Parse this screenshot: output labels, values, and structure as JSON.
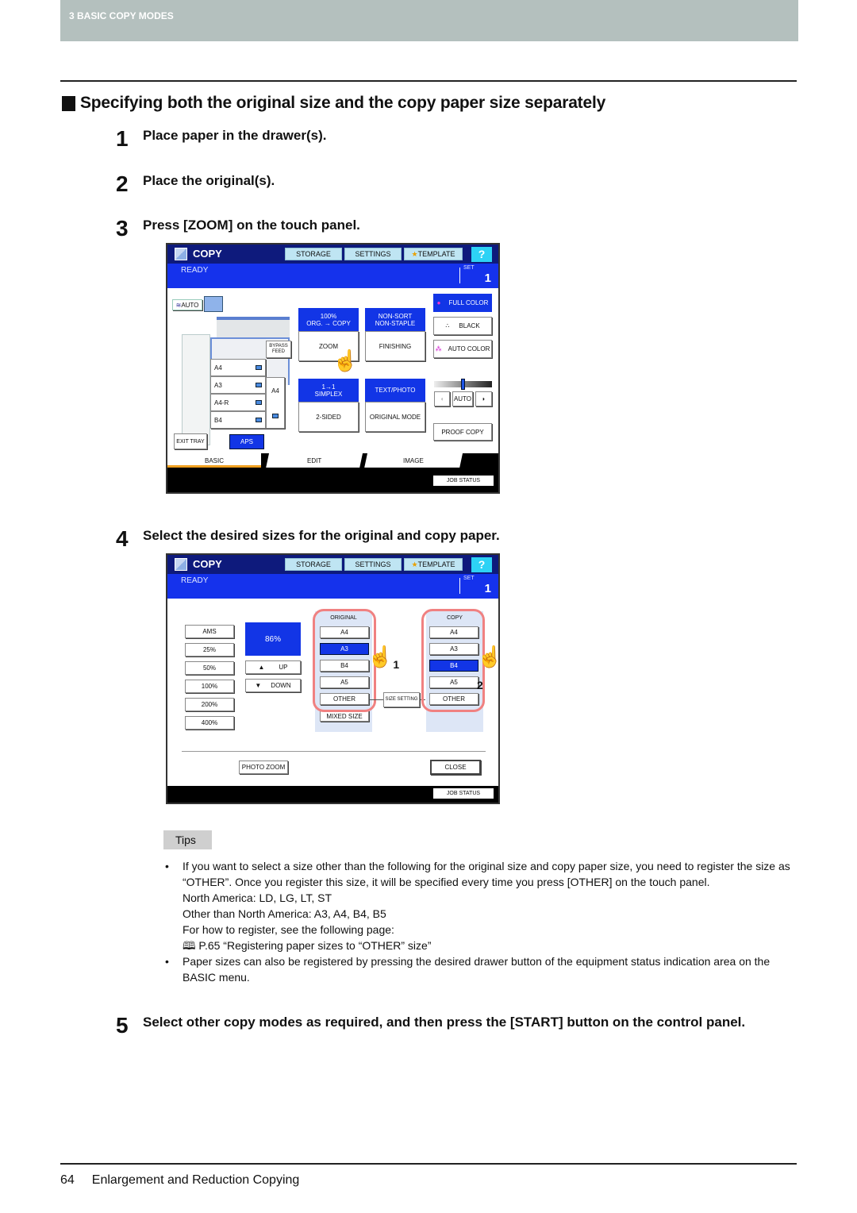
{
  "header": {
    "chapter": "3 BASIC COPY MODES"
  },
  "section_title": "Specifying both the original size and the copy paper size separately",
  "steps": [
    {
      "num": "1",
      "text": "Place paper in the drawer(s)."
    },
    {
      "num": "2",
      "text": "Place the original(s)."
    },
    {
      "num": "3",
      "text": "Press [ZOOM] on the touch panel."
    },
    {
      "num": "4",
      "text": "Select the desired sizes for the original and copy paper."
    },
    {
      "num": "5",
      "text": "Select other copy modes as required, and then press the [START] button on the control panel."
    }
  ],
  "panel_common": {
    "title": "COPY",
    "storage": "STORAGE",
    "settings": "SETTINGS",
    "template": "TEMPLATE",
    "help": "?",
    "status": "READY",
    "set_label": "SET",
    "set_value": "1",
    "job_status": "JOB STATUS"
  },
  "panel1": {
    "auto": "AUTO",
    "bypass_feed": "BYPASS FEED",
    "drawers": [
      "A4",
      "A3",
      "A4-R",
      "B4"
    ],
    "lcf": "A4",
    "exit_tray": "EXIT TRAY",
    "aps": "APS",
    "zoom_status": [
      "100%",
      "ORG. → COPY"
    ],
    "zoom": "ZOOM",
    "finishing_status": [
      "NON-SORT",
      "NON-STAPLE"
    ],
    "finishing": "FINISHING",
    "duplex_status": [
      "1→1",
      "SIMPLEX"
    ],
    "two_sided": "2-SIDED",
    "mode_status": "TEXT/PHOTO",
    "original_mode": "ORIGINAL MODE",
    "full_color": "FULL COLOR",
    "black": "BLACK",
    "auto_color": "AUTO COLOR",
    "density_auto": "AUTO",
    "proof_copy": "PROOF COPY",
    "tabs": [
      "BASIC",
      "EDIT",
      "IMAGE"
    ]
  },
  "panel2": {
    "presets": [
      "AMS",
      "25%",
      "50%",
      "100%",
      "200%",
      "400%"
    ],
    "zoom_value": "86%",
    "up": "UP",
    "down": "DOWN",
    "original_label": "ORIGINAL",
    "original_sizes": [
      "A4",
      "A3",
      "B4",
      "A5",
      "OTHER"
    ],
    "original_selected": "A3",
    "mixed_size": "MIXED SIZE",
    "size_setting": "SIZE SETTING",
    "copy_label": "COPY",
    "copy_sizes": [
      "A4",
      "A3",
      "B4",
      "A5",
      "OTHER"
    ],
    "copy_selected": "B4",
    "photo_zoom": "PHOTO ZOOM",
    "close": "CLOSE",
    "callouts": [
      "1",
      "2"
    ]
  },
  "tips": {
    "label": "Tips",
    "bullet1": "If you want to select a size other than the following for the original size and copy paper size, you need to register the size as “OTHER”. Once you register this size, it will be specified every time you press [OTHER] on the touch panel.",
    "na": "North America: LD, LG, LT, ST",
    "other": "Other than North America: A3, A4, B4, B5",
    "howto": "For how to register, see the following page:",
    "ref": "P.65 “Registering paper sizes to “OTHER” size”",
    "bullet2": "Paper sizes can also be registered by pressing the desired drawer button of the equipment status indication area on the BASIC menu."
  },
  "footer": {
    "page": "64",
    "title": "Enlargement and Reduction Copying"
  },
  "colors": {
    "accent_blue": "#1235e6",
    "title_bar": "#0e1a7c",
    "highlight": "#f08181",
    "tab_active": "#f0a020"
  }
}
